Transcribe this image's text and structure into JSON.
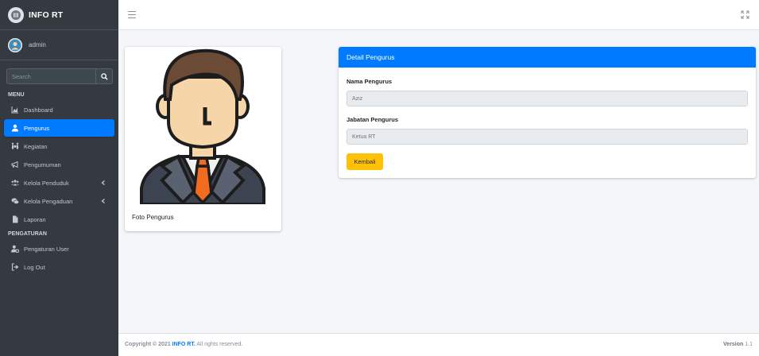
{
  "brand": {
    "title": "INFO RT"
  },
  "user": {
    "name": "admin"
  },
  "search": {
    "placeholder": "Search"
  },
  "sidebar": {
    "sections": [
      {
        "header": "MENU"
      },
      {
        "header": "PENGATURAN"
      }
    ],
    "items": [
      {
        "label": "Dashboard",
        "icon": "chart-area-icon"
      },
      {
        "label": "Pengurus",
        "icon": "user-icon"
      },
      {
        "label": "Kegiatan",
        "icon": "people-carry-icon"
      },
      {
        "label": "Pengumuman",
        "icon": "bullhorn-icon"
      },
      {
        "label": "Kelola Penduduk",
        "icon": "users-icon"
      },
      {
        "label": "Kelola Pengaduan",
        "icon": "comments-icon"
      },
      {
        "label": "Laporan",
        "icon": "file-icon"
      },
      {
        "label": "Pengaturan User",
        "icon": "user-cog-icon"
      },
      {
        "label": "Log Out",
        "icon": "sign-out-icon"
      }
    ],
    "active_item": "Pengurus"
  },
  "photo_card": {
    "caption": "Foto Pengurus"
  },
  "detail": {
    "header": "Detail Pengurus",
    "fields": [
      {
        "label": "Nama Pengurus",
        "value": "Aziz"
      },
      {
        "label": "Jabatan Pengurus",
        "value": "Ketua RT"
      }
    ],
    "back_button": "Kembali"
  },
  "footer": {
    "copyright_prefix": "Copyright © 2021",
    "brand": "INFO RT.",
    "rights": "All rights reserved.",
    "version_label": "Version",
    "version_number": "1.1"
  },
  "colors": {
    "sidebar_bg": "#343a40",
    "accent": "#007bff",
    "button_warning": "#ffc107",
    "content_bg": "#f4f6f9"
  }
}
